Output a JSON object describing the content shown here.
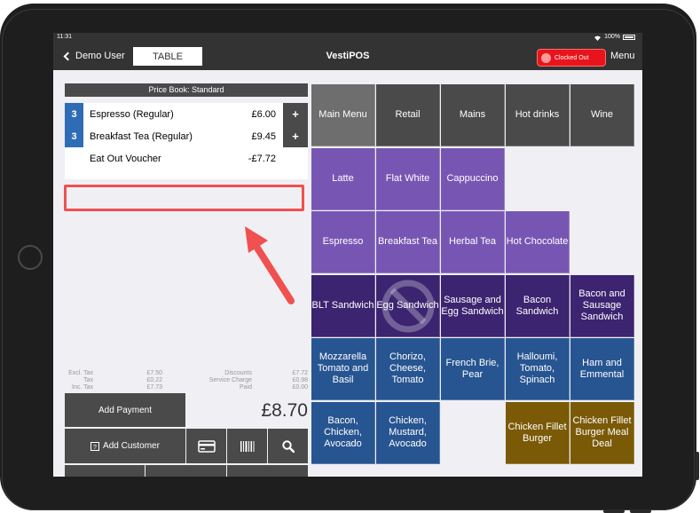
{
  "status": {
    "time": "11:31",
    "battery": "100%"
  },
  "nav": {
    "back_label": "Demo User",
    "table_label": "TABLE",
    "title": "VestiPOS",
    "clocked_label": "Clocked Out",
    "menu_label": "Menu"
  },
  "order": {
    "pricebook": "Price Book: Standard",
    "items": [
      {
        "qty": "3",
        "name": "Espresso (Regular)",
        "price": "£6.00",
        "plus": "+"
      },
      {
        "qty": "3",
        "name": "Breakfast Tea (Regular)",
        "price": "£9.45",
        "plus": "+"
      },
      {
        "qty": "",
        "name": "Eat Out Voucher",
        "price": "-£7.72",
        "plus": ""
      }
    ]
  },
  "totals": {
    "excl_tax_label": "Excl. Tax",
    "excl_tax": "£7.50",
    "tax_label": "Tax",
    "tax": "£0.22",
    "inc_tax_label": "Inc. Tax",
    "inc_tax": "£7.73",
    "discounts_label": "Discounts",
    "discounts": "£7.72",
    "service_label": "Service Charge",
    "service": "£0.98",
    "paid_label": "Paid",
    "paid": "£0.00",
    "grand_total": "£8.70"
  },
  "actions": {
    "add_payment": "Add Payment",
    "add_customer": "Add Customer"
  },
  "categories": [
    "Main Menu",
    "Retail",
    "Mains",
    "Hot drinks",
    "Wine"
  ],
  "products": [
    {
      "label": "Latte",
      "color": "#7756b3"
    },
    {
      "label": "Flat White",
      "color": "#7756b3"
    },
    {
      "label": "Cappuccino",
      "color": "#7756b3"
    },
    {
      "label": "Espresso",
      "color": "#7756b3"
    },
    {
      "label": "Breakfast Tea",
      "color": "#7756b3"
    },
    {
      "label": "Herbal Tea",
      "color": "#7756b3"
    },
    {
      "label": "Hot Chocolate",
      "color": "#7756b3"
    },
    {
      "label": "BLT Sandwich",
      "color": "#3c2470"
    },
    {
      "label": "Egg Sandwich",
      "color": "#3c2470"
    },
    {
      "label": "Sausage and Egg Sandwich",
      "color": "#3c2470"
    },
    {
      "label": "Bacon Sandwich",
      "color": "#3c2470"
    },
    {
      "label": "Bacon and Sausage Sandwich",
      "color": "#3c2470"
    },
    {
      "label": "Mozzarella Tomato and Basil",
      "color": "#275591"
    },
    {
      "label": "Chorizo, Cheese, Tomato",
      "color": "#275591"
    },
    {
      "label": "French Brie, Pear",
      "color": "#275591"
    },
    {
      "label": "Halloumi, Tomato, Spinach",
      "color": "#275591"
    },
    {
      "label": "Ham and Emmental",
      "color": "#275591"
    },
    {
      "label": "Bacon, Chicken, Avocado",
      "color": "#275591"
    },
    {
      "label": "Chicken, Mustard, Avocado",
      "color": "#275591"
    },
    {
      "label": "Chicken Fillet Burger",
      "color": "#7a5a07"
    },
    {
      "label": "Chicken Fillet Burger Meal Deal",
      "color": "#7a5a07"
    }
  ],
  "icons": {
    "card": "card-icon",
    "barcode": "barcode-icon",
    "search": "search-icon",
    "save": "save-icon",
    "print": "print-icon",
    "more": "more-icon",
    "customer": "customer-icon",
    "unavailable": "unavailable-icon"
  },
  "colors": {
    "category": "#4a4a4a",
    "category_active": "#6e6e6e",
    "highlight": "#f05050",
    "clocked": "#e8141b"
  }
}
